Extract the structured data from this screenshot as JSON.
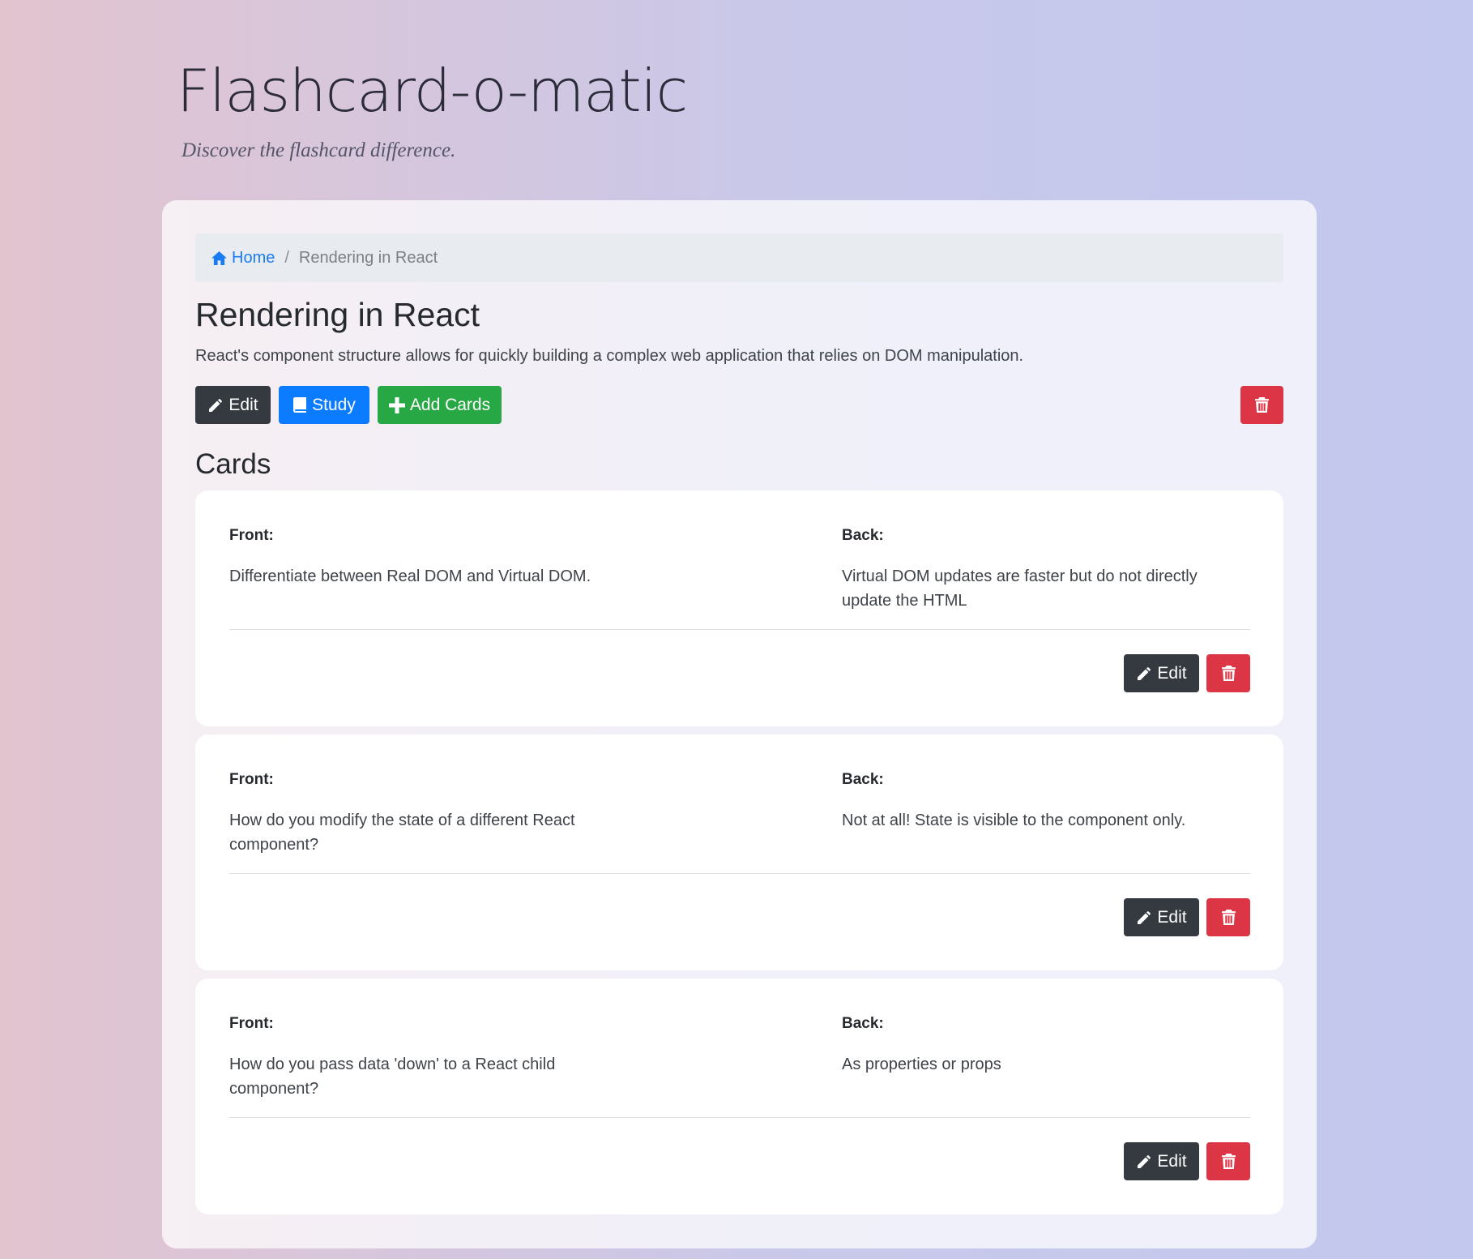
{
  "app": {
    "title": "Flashcard-o-matic",
    "tagline": "Discover the flashcard difference."
  },
  "breadcrumb": {
    "home_label": "Home",
    "separator": "/",
    "current": "Rendering in React"
  },
  "deck": {
    "name": "Rendering in React",
    "description": "React's component structure allows for quickly building a complex web application that relies on DOM manipulation.",
    "actions": {
      "edit_label": "Edit",
      "study_label": "Study",
      "add_cards_label": "Add Cards"
    }
  },
  "cards_section": {
    "heading": "Cards",
    "front_label": "Front:",
    "back_label": "Back:",
    "edit_label": "Edit",
    "items": [
      {
        "front": "Differentiate between Real DOM and Virtual DOM.",
        "back": "Virtual DOM updates are faster but do not directly update the HTML"
      },
      {
        "front": "How do you modify the state of a different React component?",
        "back": "Not at all! State is visible to the component only."
      },
      {
        "front": "How do you pass data 'down' to a React child component?",
        "back": "As properties or props"
      }
    ]
  },
  "icons": {
    "home": "home-icon",
    "pencil": "pencil-icon",
    "book": "book-icon",
    "plus": "plus-icon",
    "trash": "trash-icon"
  },
  "colors": {
    "dark_button": "#343a40",
    "study_button": "#0b7bff",
    "add_button": "#28a745",
    "delete_button": "#dc3545",
    "link": "#1a7cf2"
  }
}
